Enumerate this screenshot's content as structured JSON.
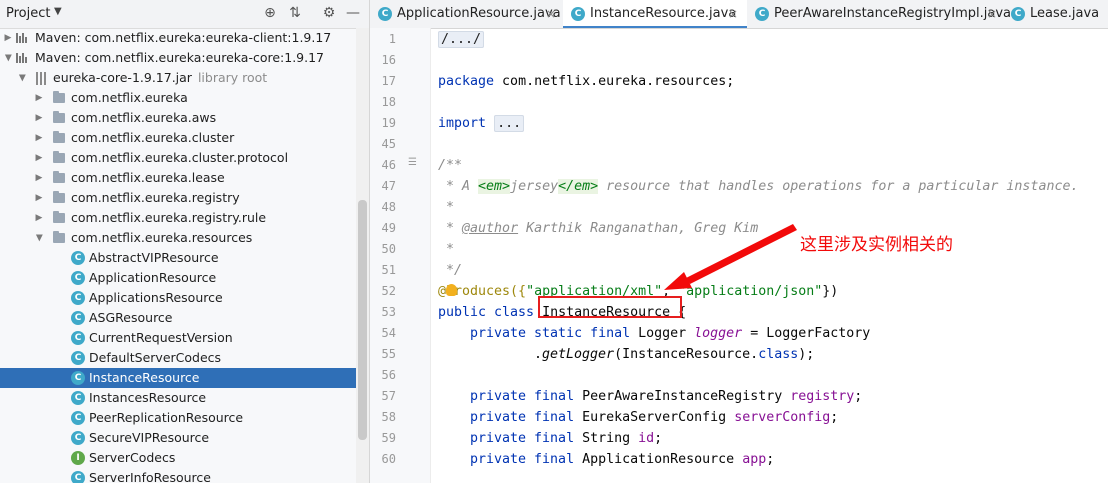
{
  "project_panel": {
    "title": "Project",
    "icons": [
      "target-icon",
      "collapse-all-icon",
      "gear-icon",
      "minimize-icon"
    ],
    "tree": [
      {
        "label": "Maven: com.netflix.eureka:eureka-client:1.9.17",
        "icon": "maven-library-icon",
        "expanded": false
      },
      {
        "label": "Maven: com.netflix.eureka:eureka-core:1.9.17",
        "icon": "maven-library-icon",
        "expanded": true
      },
      {
        "label": "eureka-core-1.9.17.jar",
        "note": "library root",
        "icon": "jar-icon",
        "expanded": true
      },
      {
        "label": "com.netflix.eureka",
        "icon": "package-icon"
      },
      {
        "label": "com.netflix.eureka.aws",
        "icon": "package-icon"
      },
      {
        "label": "com.netflix.eureka.cluster",
        "icon": "package-icon"
      },
      {
        "label": "com.netflix.eureka.cluster.protocol",
        "icon": "package-icon"
      },
      {
        "label": "com.netflix.eureka.lease",
        "icon": "package-icon"
      },
      {
        "label": "com.netflix.eureka.registry",
        "icon": "package-icon"
      },
      {
        "label": "com.netflix.eureka.registry.rule",
        "icon": "package-icon"
      },
      {
        "label": "com.netflix.eureka.resources",
        "icon": "package-icon",
        "expanded": true
      },
      {
        "label": "AbstractVIPResource",
        "icon": "class-icon"
      },
      {
        "label": "ApplicationResource",
        "icon": "class-icon"
      },
      {
        "label": "ApplicationsResource",
        "icon": "class-icon"
      },
      {
        "label": "ASGResource",
        "icon": "class-icon"
      },
      {
        "label": "CurrentRequestVersion",
        "icon": "class-icon"
      },
      {
        "label": "DefaultServerCodecs",
        "icon": "class-icon"
      },
      {
        "label": "InstanceResource",
        "icon": "class-icon",
        "selected": true
      },
      {
        "label": "InstancesResource",
        "icon": "class-icon"
      },
      {
        "label": "PeerReplicationResource",
        "icon": "class-icon"
      },
      {
        "label": "SecureVIPResource",
        "icon": "class-icon"
      },
      {
        "label": "ServerCodecs",
        "icon": "interface-icon"
      },
      {
        "label": "ServerInfoResource",
        "icon": "class-icon"
      }
    ]
  },
  "tabs": [
    {
      "label": "ApplicationResource.java",
      "active": false
    },
    {
      "label": "InstanceResource.java",
      "active": true
    },
    {
      "label": "PeerAwareInstanceRegistryImpl.java",
      "active": false
    },
    {
      "label": "Lease.java",
      "active": false
    }
  ],
  "editor": {
    "line_numbers": [
      "1",
      "16",
      "17",
      "18",
      "19",
      "45",
      "46",
      "47",
      "48",
      "49",
      "50",
      "51",
      "52",
      "53",
      "54",
      "55",
      "56",
      "57",
      "58",
      "59",
      "60"
    ],
    "code": {
      "l1": "/.../",
      "l17_kw": "package",
      "l17_rest": " com.netflix.eureka.resources;",
      "l19_kw": "import",
      "l19_fold": "...",
      "l46": "/**",
      "l47_a": " * A ",
      "l47_tag1": "<em>",
      "l47_b": "jersey",
      "l47_tag2": "</em>",
      "l47_c": " resource that handles operations for a particular instance.",
      "l48": " *",
      "l49_a": " * ",
      "l49_tag": "@author",
      "l49_b": " Karthik Ranganathan, Greg Kim",
      "l50": " *",
      "l51": " */",
      "l52_a": "@Produces({",
      "l52_s1": "\"application/xml\"",
      "l52_b": ", ",
      "l52_s2": "\"application/json\"",
      "l52_c": "})",
      "l53_kw": "public class",
      "l53_rest": " InstanceResource {",
      "l54_kw": "private static final",
      "l54_type": " Logger ",
      "l54_var": "logger",
      "l54_rest": " = LoggerFactory",
      "l55_a": ".",
      "l55_m": "getLogger",
      "l55_b": "(InstanceResource.",
      "l55_kw": "class",
      "l55_c": ");",
      "l57_kw": "private final",
      "l57_type": " PeerAwareInstanceRegistry ",
      "l57_var": "registry",
      "l57_end": ";",
      "l58_kw": "private final",
      "l58_type": " EurekaServerConfig ",
      "l58_var": "serverConfig",
      "l58_end": ";",
      "l59_kw": "private final",
      "l59_type": " String ",
      "l59_var": "id",
      "l59_end": ";",
      "l60_kw": "private final",
      "l60_type": " ApplicationResource ",
      "l60_var": "app",
      "l60_end": ";"
    }
  },
  "annotation": {
    "text": "这里涉及实例相关的",
    "color": "#f20a0a"
  },
  "colors": {
    "selection": "#2f6fb7",
    "keyword": "#0033b3",
    "string": "#067d17",
    "field": "#871094",
    "comment": "#8c8c8c"
  }
}
